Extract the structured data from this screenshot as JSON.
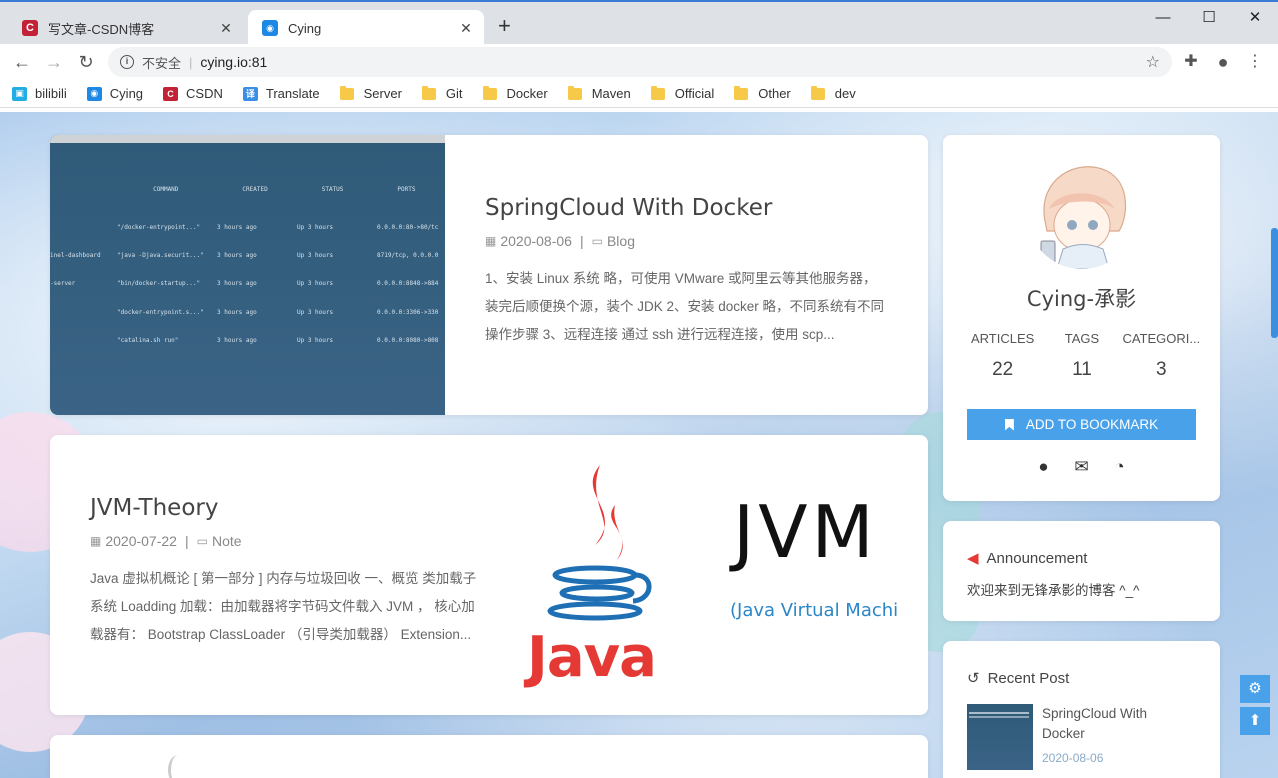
{
  "browser": {
    "tabs": [
      {
        "title": "写文章-CSDN博客",
        "favicon": "C",
        "favicon_color": "#c32136",
        "active": false
      },
      {
        "title": "Cying",
        "favicon": "💬",
        "favicon_color": "#1e88e5",
        "active": true
      }
    ],
    "new_tab": "+",
    "window_controls": {
      "minimize": "—",
      "maximize": "☐",
      "close": "✕"
    },
    "address": {
      "security_label": "不安全",
      "url": "cying.io:81"
    },
    "bookmarks": [
      {
        "label": "bilibili",
        "type": "site",
        "icon": "tv",
        "color": "#23ade5"
      },
      {
        "label": "Cying",
        "type": "site",
        "icon": "chat",
        "color": "#1e88e5"
      },
      {
        "label": "CSDN",
        "type": "site",
        "icon": "C",
        "color": "#c32136"
      },
      {
        "label": "Translate",
        "type": "site",
        "icon": "译",
        "color": "#3a8ee6"
      },
      {
        "label": "Server",
        "type": "folder"
      },
      {
        "label": "Git",
        "type": "folder"
      },
      {
        "label": "Docker",
        "type": "folder"
      },
      {
        "label": "Maven",
        "type": "folder"
      },
      {
        "label": "Official",
        "type": "folder"
      },
      {
        "label": "Other",
        "type": "folder"
      },
      {
        "label": "dev",
        "type": "folder"
      }
    ]
  },
  "posts": [
    {
      "title": "SpringCloud With Docker",
      "date": "2020-08-06",
      "category": "Blog",
      "excerpt": "1、安装 Linux 系统 略，可使用 VMware 或阿里云等其他服务器，装完后顺便换个源，装个 JDK 2、安装 docker 略，不同系统有不同操作步骤 3、远程连接 通过 ssh 进行远程连接，使用 scp...",
      "terminal": {
        "headers": [
          "COMMAND",
          "CREATED",
          "STATUS",
          "PORTS"
        ],
        "rows": [
          [
            "",
            "\"/docker-entrypoint...\"",
            "3 hours ago",
            "Up 3 hours",
            "0.0.0.0:80->80/tc"
          ],
          [
            "inel-dashboard",
            "\"java -Djava.securit...\"",
            "3 hours ago",
            "Up 3 hours",
            "8719/tcp, 0.0.0.0"
          ],
          [
            "-server",
            "\"bin/docker-startup...\"",
            "3 hours ago",
            "Up 3 hours",
            "0.0.0.0:8848->884"
          ],
          [
            "",
            "\"docker-entrypoint.s...\"",
            "3 hours ago",
            "Up 3 hours",
            "0.0.0.0:3306->330"
          ],
          [
            "",
            "\"catalina.sh run\"",
            "3 hours ago",
            "Up 3 hours",
            "0.0.0.0:8080->808"
          ]
        ]
      }
    },
    {
      "title": "JVM-Theory",
      "date": "2020-07-22",
      "category": "Note",
      "excerpt": "Java 虚拟机概论 [ 第一部分 ] 内存与垃圾回收 一、概览 类加载子系统 Loadding 加载：由加载器将字节码文件载入 JVM ， 核心加载器有： Bootstrap ClassLoader （引导类加载器） Extension...",
      "art": {
        "java_word": "Java",
        "jvm_word": "JVM",
        "jvm_sub": "(Java Virtual Machi"
      }
    }
  ],
  "sidebar": {
    "author": "Cying-承影",
    "stats": [
      {
        "label": "ARTICLES",
        "value": "22"
      },
      {
        "label": "TAGS",
        "value": "11"
      },
      {
        "label": "CATEGORI...",
        "value": "3"
      }
    ],
    "bookmark_button": "ADD TO BOOKMARK",
    "announcement": {
      "title": "Announcement",
      "text": "欢迎来到无锋承影的博客 ^_^"
    },
    "recent": {
      "title": "Recent Post",
      "items": [
        {
          "title": "SpringCloud With Docker",
          "date": "2020-08-06"
        }
      ]
    }
  },
  "colors": {
    "accent": "#49a2e9",
    "link_date": "#8aaac8",
    "announcement_icon": "#e53935"
  }
}
